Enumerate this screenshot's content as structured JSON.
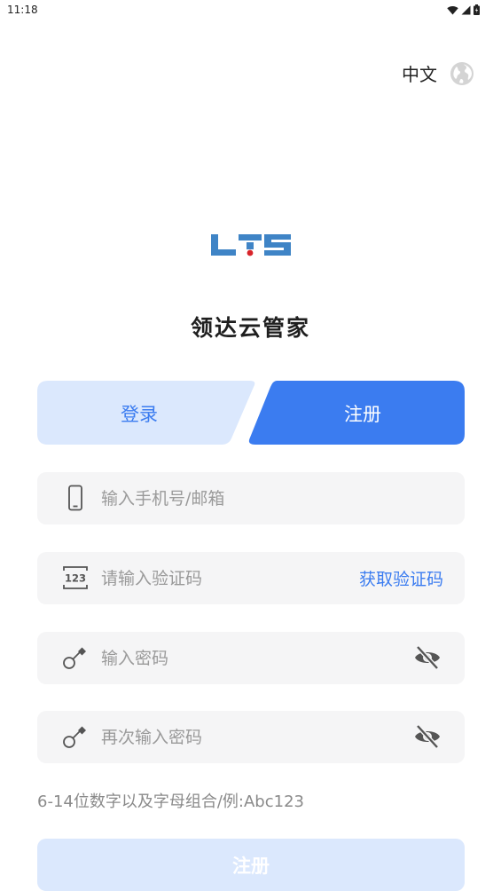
{
  "status_bar": {
    "time": "11:18",
    "icons": [
      "wifi-icon",
      "signal-icon",
      "battery-icon"
    ]
  },
  "language": {
    "label": "中文",
    "icon": "globe-icon"
  },
  "app": {
    "logo_text": "LTS",
    "title": "领达云管家"
  },
  "tabs": {
    "login": "登录",
    "register": "注册",
    "active": "register"
  },
  "form": {
    "account": {
      "placeholder": "输入手机号/邮箱",
      "icon": "phone-icon"
    },
    "code": {
      "placeholder": "请输入验证码",
      "icon": "code-123-icon",
      "icon_text": "123",
      "action": "获取验证码"
    },
    "password": {
      "placeholder": "输入密码",
      "icon": "key-icon",
      "toggle_icon": "eye-off-icon"
    },
    "confirm_password": {
      "placeholder": "再次输入密码",
      "icon": "key-icon",
      "toggle_icon": "eye-off-icon"
    },
    "hint": "6-14位数字以及字母组合/例:Abc123",
    "submit": "注册"
  },
  "colors": {
    "primary": "#3b7cf0",
    "tab_inactive_bg": "#dbe8fd",
    "field_bg": "#f5f5f6",
    "logo_blue": "#3f84c6",
    "logo_red": "#d8242a"
  }
}
